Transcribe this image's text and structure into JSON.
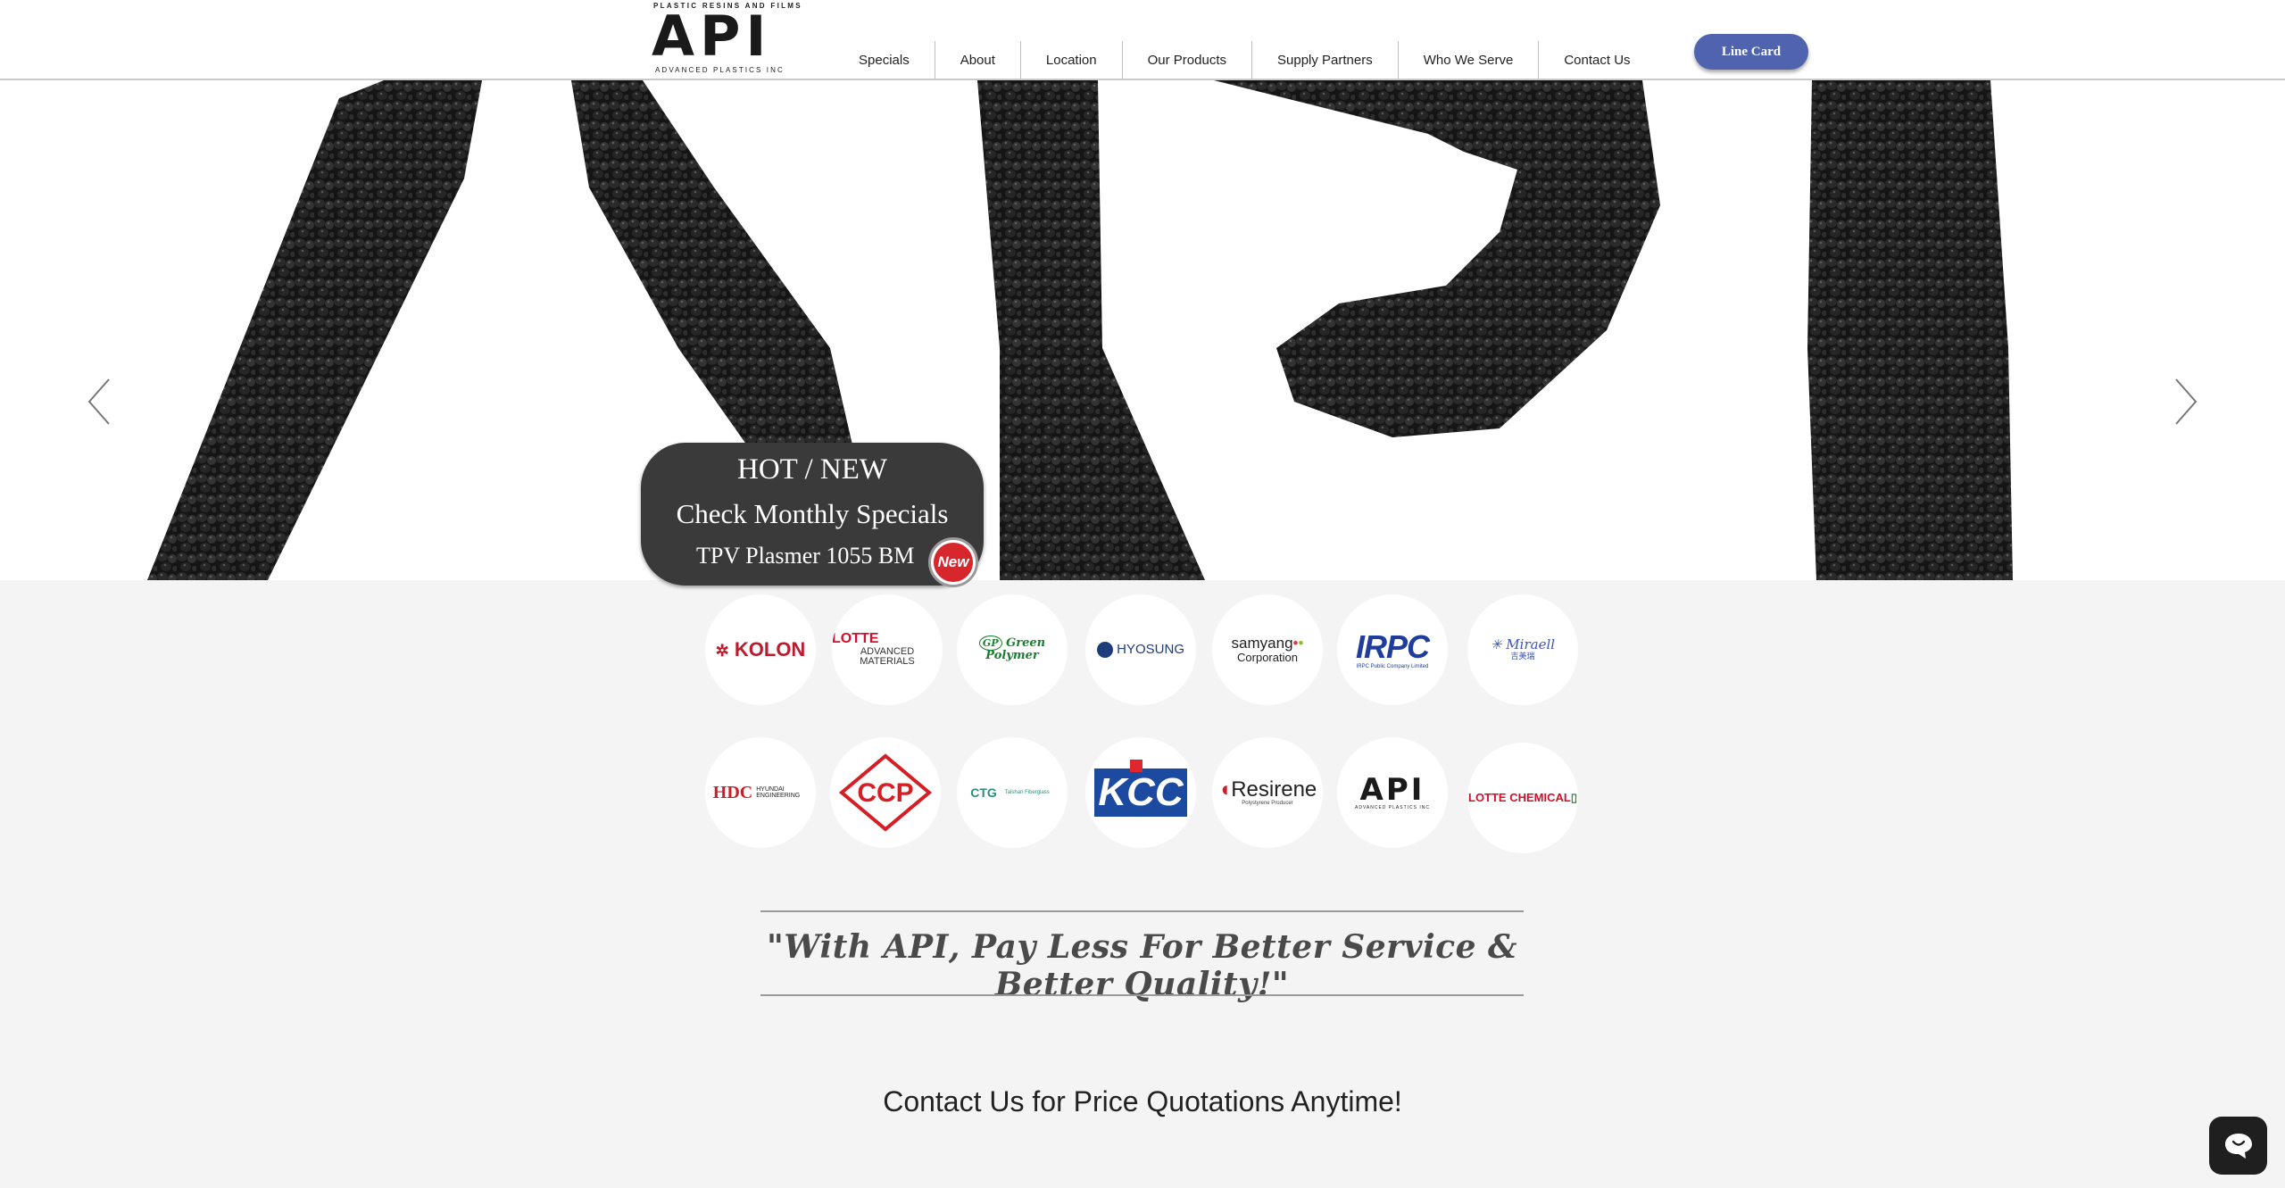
{
  "header": {
    "logo_tagline": "PLASTIC RESINS AND FILMS",
    "logo_text": "API",
    "logo_subtitle": "ADVANCED PLASTICS INC",
    "nav": [
      "Specials",
      "About",
      "Location",
      "Our Products",
      "Supply Partners",
      "Who We Serve",
      "Contact Us"
    ],
    "line_card_label": "Line Card",
    "line_card_color": "#4f63ae"
  },
  "hero": {
    "background_text": "API",
    "prev_icon": "chevron-left-icon",
    "next_icon": "chevron-right-icon",
    "promo": {
      "line1": "HOT / NEW",
      "line2": "Check Monthly Specials",
      "line3": "TPV Plasmer 1055 BM",
      "badge": "New"
    },
    "slide_count": 4
  },
  "partners": {
    "row1": [
      {
        "name": "KOLON",
        "sub": ""
      },
      {
        "name": "LOTTE",
        "sub": "ADVANCED MATERIALS"
      },
      {
        "name": "Green Polymer",
        "sub": ""
      },
      {
        "name": "HYOSUNG",
        "sub": ""
      },
      {
        "name": "samyang",
        "sub": "Corporation"
      },
      {
        "name": "IRPC",
        "sub": "IRPC Public Company Limited"
      },
      {
        "name": "Miraell",
        "sub": "吉美瑞"
      }
    ],
    "row2": [
      {
        "name": "HDC",
        "sub": "HYUNDAI ENGINEERING"
      },
      {
        "name": "CCP",
        "sub": ""
      },
      {
        "name": "CTG",
        "sub": "Taishan Fiberglass"
      },
      {
        "name": "KCC",
        "sub": ""
      },
      {
        "name": "Resirene",
        "sub": "Polystyrene Producer"
      },
      {
        "name": "API",
        "sub": "ADVANCED PLASTICS INC"
      },
      {
        "name": "LOTTE CHEMICAL",
        "sub": ""
      }
    ]
  },
  "slogan": "\"With API, Pay Less For Better Service & Better Quality!\"",
  "contact_heading": "Contact Us for Price Quotations Anytime!",
  "chat_icon": "chat-bubble-icon"
}
